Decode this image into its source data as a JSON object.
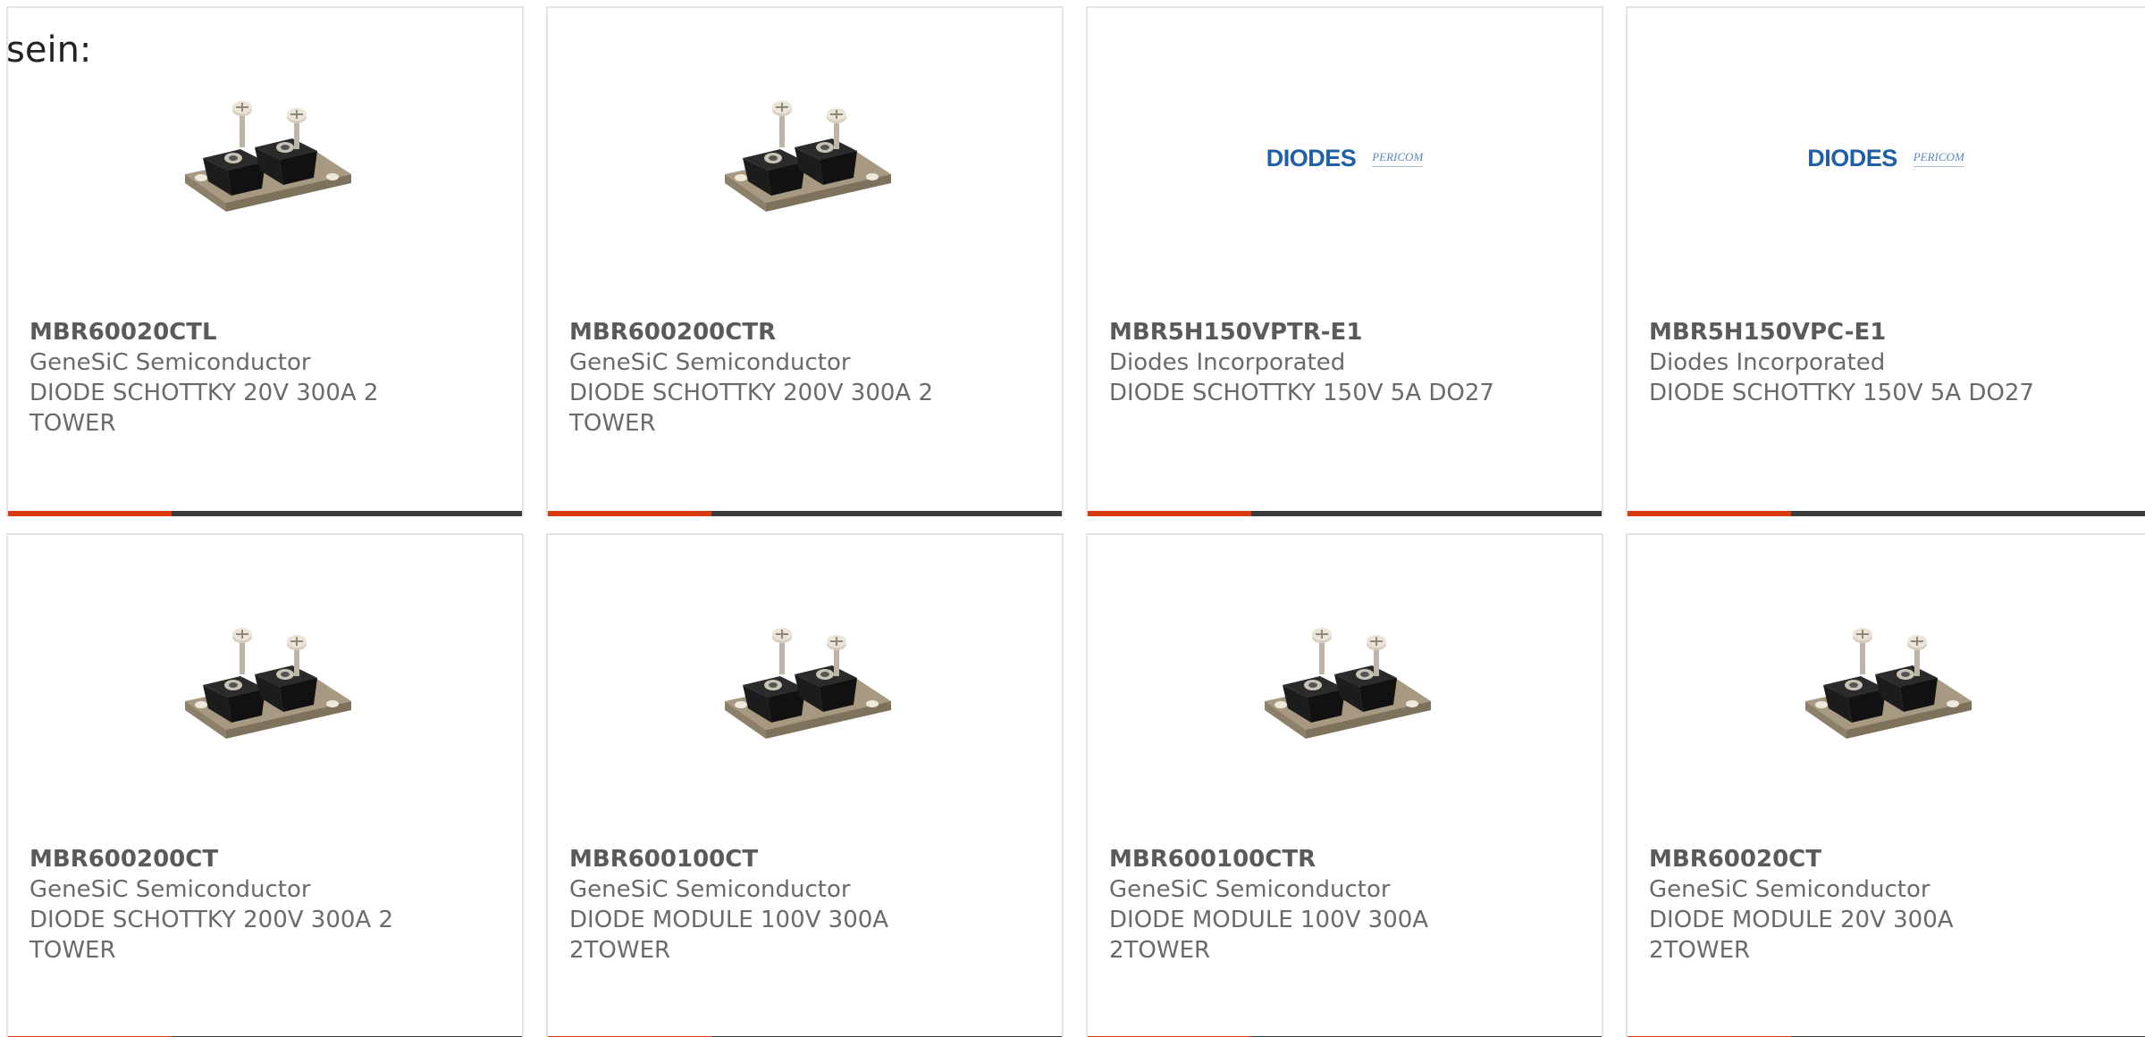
{
  "intro_text": "sein:",
  "brand": {
    "accent_color": "#d93b12",
    "bar_color": "#3b3b3b"
  },
  "products": [
    {
      "part": "MBR60020CTL",
      "manufacturer": "GeneSiC Semiconductor",
      "description": "DIODE SCHOTTKY 20V 300A 2 TOWER",
      "image": "diode-module-photo"
    },
    {
      "part": "MBR600200CTR",
      "manufacturer": "GeneSiC Semiconductor",
      "description": "DIODE SCHOTTKY 200V 300A 2 TOWER",
      "image": "diode-module-photo"
    },
    {
      "part": "MBR5H150VPTR-E1",
      "manufacturer": "Diodes Incorporated",
      "description": "DIODE SCHOTTKY 150V 5A DO27",
      "image": "diodes-logo",
      "logo_text": "DIODES",
      "logo_sub": "PERICOM"
    },
    {
      "part": "MBR5H150VPC-E1",
      "manufacturer": "Diodes Incorporated",
      "description": "DIODE SCHOTTKY 150V 5A DO27",
      "image": "diodes-logo",
      "logo_text": "DIODES",
      "logo_sub": "PERICOM"
    },
    {
      "part": "MBR600200CT",
      "manufacturer": "GeneSiC Semiconductor",
      "description": "DIODE SCHOTTKY 200V 300A 2 TOWER",
      "image": "diode-module-photo"
    },
    {
      "part": "MBR600100CT",
      "manufacturer": "GeneSiC Semiconductor",
      "description": "DIODE MODULE 100V 300A 2TOWER",
      "image": "diode-module-photo"
    },
    {
      "part": "MBR600100CTR",
      "manufacturer": "GeneSiC Semiconductor",
      "description": "DIODE MODULE 100V 300A 2TOWER",
      "image": "diode-module-photo"
    },
    {
      "part": "MBR60020CT",
      "manufacturer": "GeneSiC Semiconductor",
      "description": "DIODE MODULE 20V 300A 2TOWER",
      "image": "diode-module-photo"
    }
  ]
}
